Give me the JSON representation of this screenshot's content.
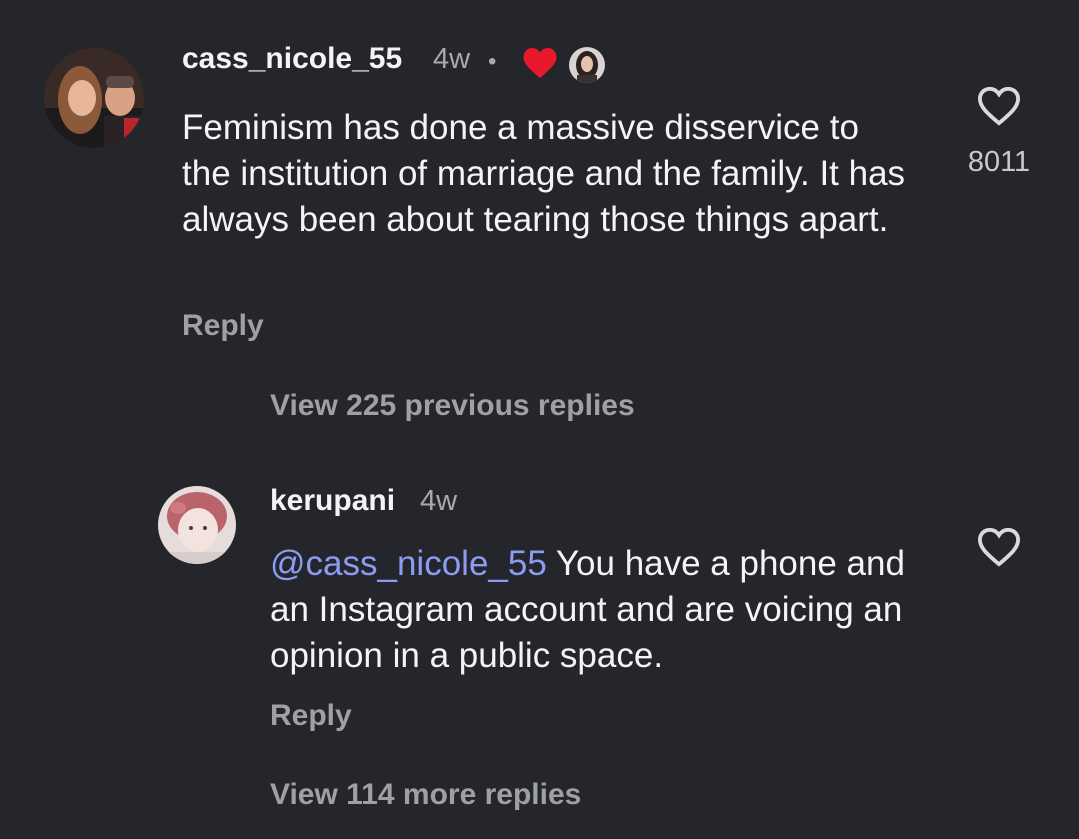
{
  "comment": {
    "username": "cass_nicole_55",
    "time": "4w",
    "separator": "•",
    "text": "Feminism has done a massive disservice to the institution of marriage and the family. It has always been about tearing those things apart.",
    "reply_label": "Reply",
    "like_count": "8011",
    "creator_like_icons": [
      "red-heart-icon",
      "creator-avatar-icon"
    ]
  },
  "view_previous": {
    "label": "View 225 previous replies"
  },
  "reply": {
    "username": "kerupani",
    "time": "4w",
    "mention": "@cass_nicole_55",
    "text": " You have a phone and an Instagram account and are voicing an opinion in a public space.",
    "reply_label": "Reply"
  },
  "view_more": {
    "label": "View 114 more replies"
  },
  "colors": {
    "background": "#24262b",
    "mention": "#8b9cf2",
    "heart_red": "#e8192c",
    "muted_text": "#9ea0a5"
  }
}
